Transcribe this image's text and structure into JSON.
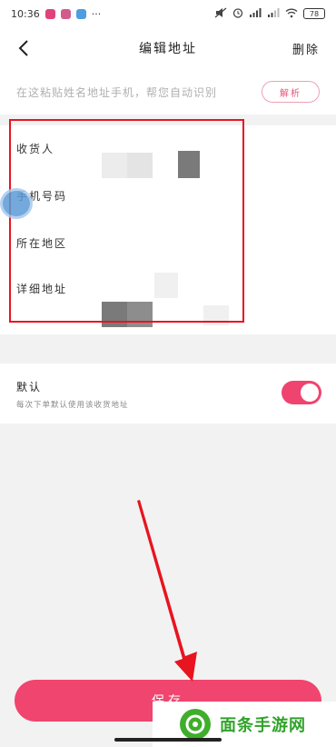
{
  "status_bar": {
    "time": "10:36",
    "dots": "···",
    "battery": "78"
  },
  "nav": {
    "title": "编辑地址",
    "delete_label": "删除"
  },
  "paste": {
    "placeholder": "在这粘贴姓名地址手机，帮您自动识别",
    "parse_label": "解析"
  },
  "form": {
    "rows": [
      {
        "label": "收货人"
      },
      {
        "label": "手机号码"
      },
      {
        "label": "所在地区"
      },
      {
        "label": "详细地址"
      }
    ]
  },
  "default_setting": {
    "title": "默认",
    "subtitle": "每次下单默认使用该收货地址",
    "enabled": true
  },
  "save_button": {
    "label": "保存"
  },
  "watermark": {
    "text": "面条手游网"
  },
  "colors": {
    "accent": "#f0456e",
    "annotation_red": "#e8141f",
    "watermark_green": "#2fa32a"
  }
}
